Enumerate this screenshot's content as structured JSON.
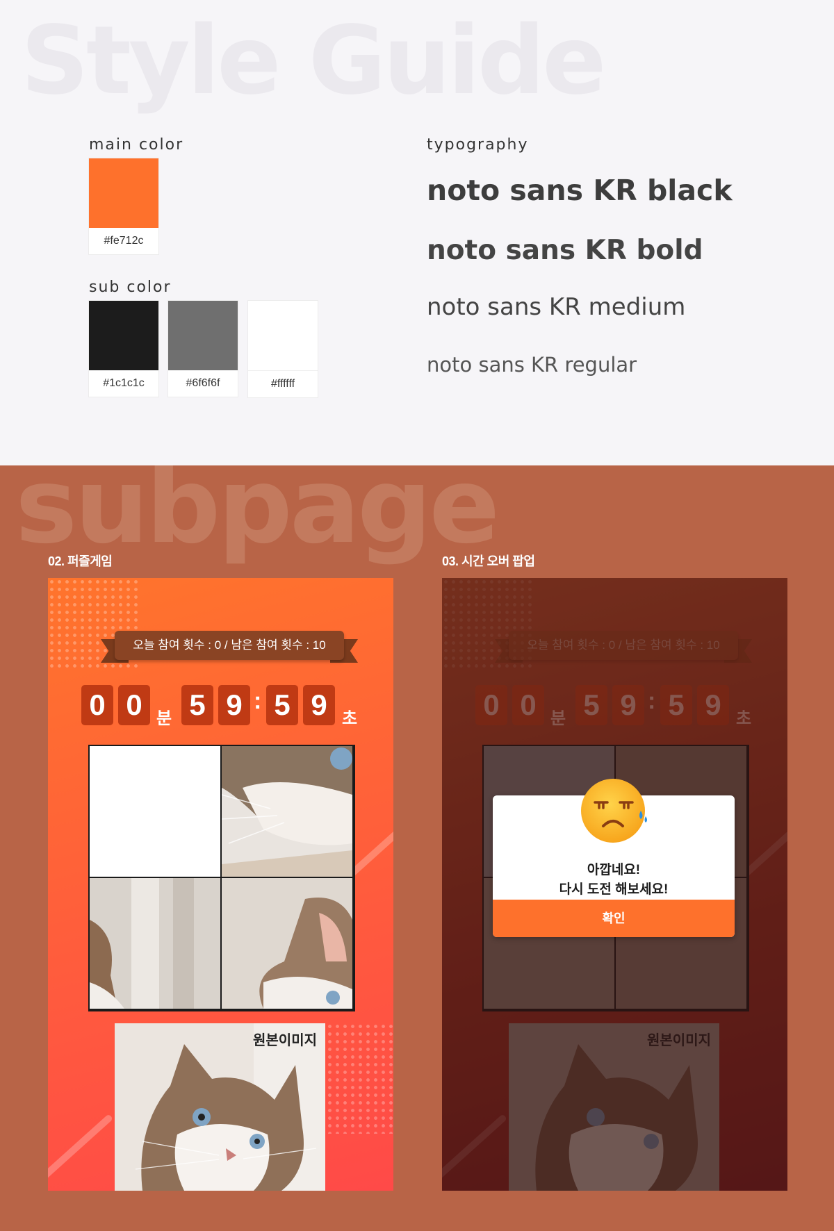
{
  "style_guide": {
    "watermark": "Style Guide",
    "main_color": {
      "label": "main color",
      "swatch": {
        "hex": "#fe712c",
        "code": "#fe712c"
      }
    },
    "sub_color": {
      "label": "sub color",
      "swatches": [
        {
          "hex": "#1c1c1c",
          "code": "#1c1c1c"
        },
        {
          "hex": "#6f6f6f",
          "code": "#6f6f6f"
        },
        {
          "hex": "#ffffff",
          "code": "#ffffff"
        }
      ]
    },
    "typography": {
      "label": "typography",
      "samples": [
        "noto sans KR black",
        "noto sans KR bold",
        "noto sans KR medium",
        "noto sans KR regular"
      ]
    }
  },
  "subpage": {
    "watermark": "subpage",
    "background_color": "#b86447",
    "puzzle": {
      "section_title": "02. 퍼즐게임",
      "ribbon": "오늘 참여 횟수 : 0  /  남은 참여 횟수 : 10",
      "timer": {
        "minutes": [
          "0",
          "0"
        ],
        "min_unit": "분",
        "seconds": [
          "5",
          "9"
        ],
        "colon": ":",
        "ms": [
          "5",
          "9"
        ],
        "sec_unit": "초"
      },
      "reference_label": "원본이미지"
    },
    "popup": {
      "section_title": "03. 시간 오버 팝업",
      "ribbon": "오늘 참여 횟수 : 0  /  남은 참여 횟수 : 10",
      "timer": {
        "minutes": [
          "0",
          "0"
        ],
        "min_unit": "분",
        "seconds": [
          "5",
          "9"
        ],
        "colon": ":",
        "ms": [
          "5",
          "9"
        ],
        "sec_unit": "초"
      },
      "reference_label": "원본이미지",
      "modal": {
        "line1": "아깝네요!",
        "line2": "다시 도전 해보세요!",
        "confirm": "확인",
        "icon": "sad-face-icon"
      }
    }
  }
}
